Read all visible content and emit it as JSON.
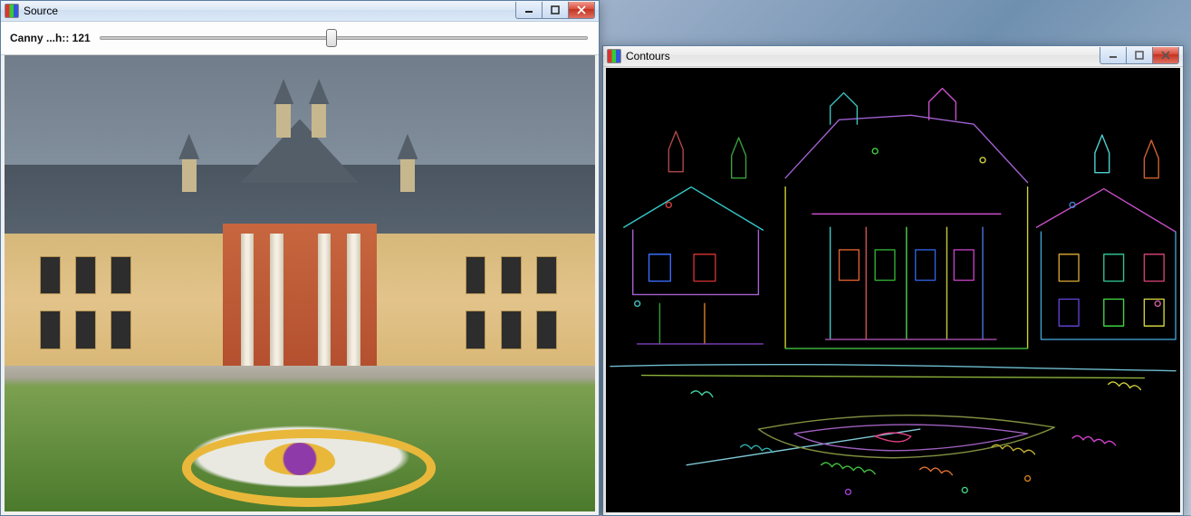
{
  "source": {
    "title": "Source",
    "slider": {
      "label_prefix": "Canny ...h:: ",
      "value": 121,
      "min": 0,
      "max": 255
    }
  },
  "contours": {
    "title": "Contours"
  },
  "window_buttons": {
    "minimize_name": "minimize",
    "maximize_name": "maximize",
    "close_name": "close"
  }
}
